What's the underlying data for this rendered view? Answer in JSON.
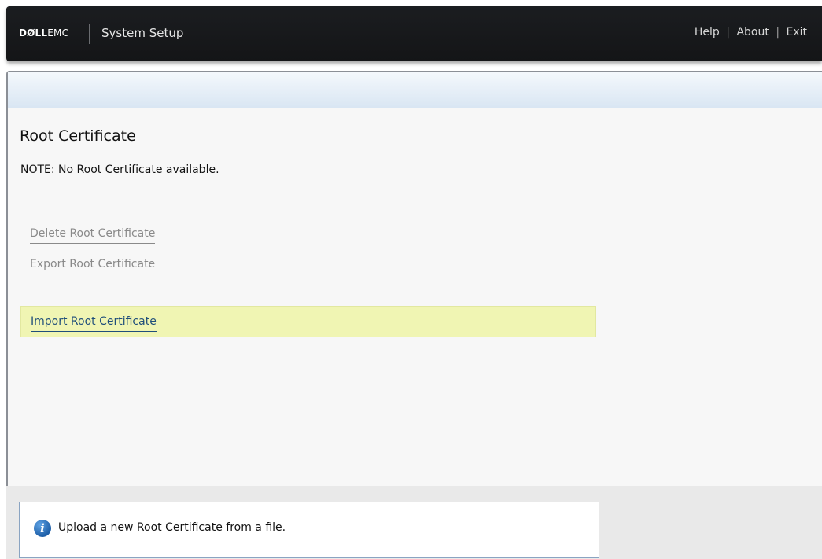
{
  "header": {
    "brand_dell": "DØLL",
    "brand_emc": "EMC",
    "app_title": "System Setup",
    "links": {
      "help": "Help",
      "about": "About",
      "exit": "Exit",
      "separator": "|"
    }
  },
  "main": {
    "page_title": "Root Certificate",
    "note": "NOTE: No Root Certificate available.",
    "actions": {
      "delete": "Delete Root Certificate",
      "export": "Export Root Certificate",
      "import": "Import Root Certificate"
    }
  },
  "help": {
    "icon_glyph": "i",
    "icon_name": "info-icon",
    "text": "Upload a new Root Certificate from a file."
  },
  "colors": {
    "header_bg": "#17181a",
    "selected_row": "#f0f5b3",
    "link_active": "#1f4e7a",
    "link_disabled": "#8a8a8a",
    "info_icon": "#1e5fa8"
  }
}
